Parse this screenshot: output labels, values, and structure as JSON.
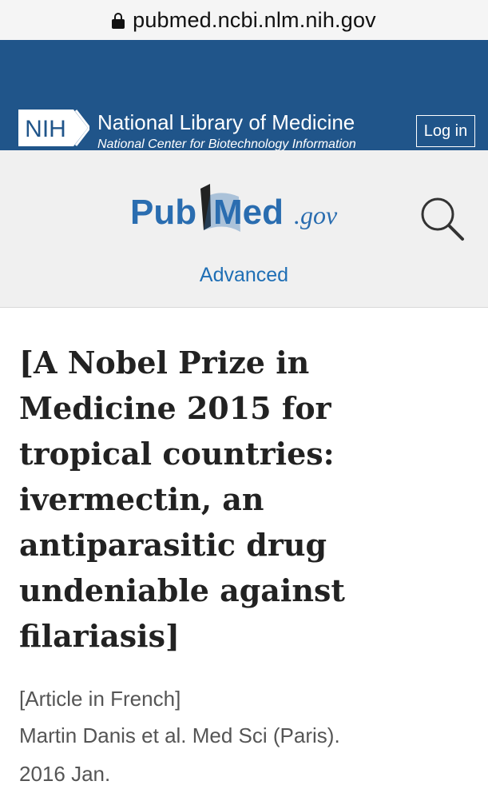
{
  "browser": {
    "url": "pubmed.ncbi.nlm.nih.gov",
    "lock_icon": "lock-icon"
  },
  "nlm_header": {
    "logo_text": "NIH",
    "title": "National Library of Medicine",
    "subtitle": "National Center for Biotechnology Information",
    "login_label": "Log in",
    "background_color": "#20558a"
  },
  "pubmed_bar": {
    "logo_pub": "Pub",
    "logo_med": "Med",
    "logo_gov": ".gov",
    "search_icon": "search-icon",
    "advanced_label": "Advanced",
    "brand_color": "#2a6db0",
    "link_color": "#1f6fb5"
  },
  "article": {
    "title": "[A Nobel Prize in Medicine 2015 for tropical countries: ivermectin, an antiparasitic drug undeniable against filariasis]",
    "language_note": "[Article in French]",
    "citation_line1": "Martin Danis et al. Med Sci (Paris).",
    "citation_line2": "2016 Jan."
  }
}
